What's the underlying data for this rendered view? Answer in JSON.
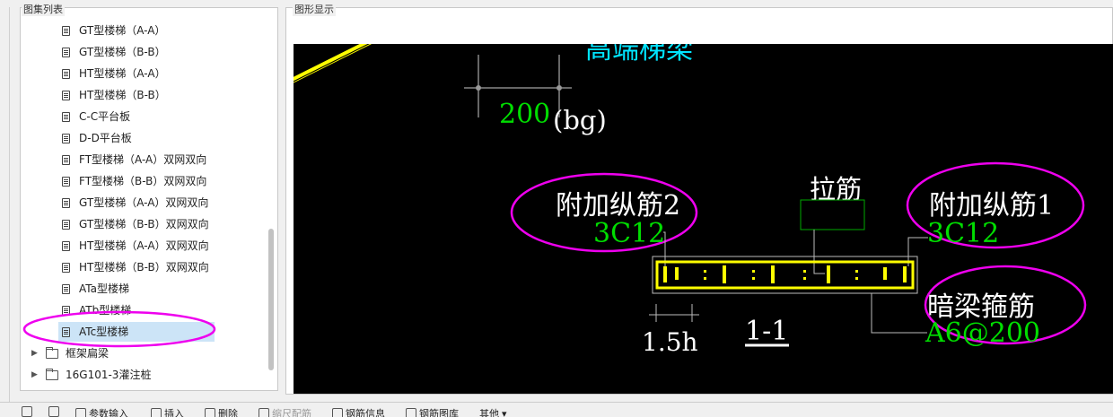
{
  "left_panel": {
    "title": "图集列表",
    "items": [
      {
        "label": "GT型楼梯（A-A）",
        "selected": false
      },
      {
        "label": "GT型楼梯（B-B）",
        "selected": false
      },
      {
        "label": "HT型楼梯（A-A）",
        "selected": false
      },
      {
        "label": "HT型楼梯（B-B）",
        "selected": false
      },
      {
        "label": "C-C平台板",
        "selected": false
      },
      {
        "label": "D-D平台板",
        "selected": false
      },
      {
        "label": "FT型楼梯（A-A）双网双向",
        "selected": false
      },
      {
        "label": "FT型楼梯（B-B）双网双向",
        "selected": false
      },
      {
        "label": "GT型楼梯（A-A）双网双向",
        "selected": false
      },
      {
        "label": "GT型楼梯（B-B）双网双向",
        "selected": false
      },
      {
        "label": "HT型楼梯（A-A）双网双向",
        "selected": false
      },
      {
        "label": "HT型楼梯（B-B）双网双向",
        "selected": false
      },
      {
        "label": "ATa型楼梯",
        "selected": false
      },
      {
        "label": "ATb型楼梯",
        "selected": false
      },
      {
        "label": "ATc型楼梯",
        "selected": true
      }
    ],
    "folders": [
      {
        "label": "框架扁梁"
      },
      {
        "label": "16G101-3灌注桩"
      }
    ]
  },
  "right_panel": {
    "title": "图形显示"
  },
  "drawing": {
    "top_label": "高端梯梁",
    "dim_value": "200",
    "dim_suffix": "(bg)",
    "label_tie": "拉筋",
    "label_add2": "附加纵筋2",
    "value_add2": "3C12",
    "label_add1": "附加纵筋1",
    "value_add1": "3C12",
    "label_stirrup": "暗梁箍筋",
    "value_stirrup": "A6@200",
    "dim_bottom": "1.5h",
    "section_label": "1-1"
  },
  "toolbar": {
    "items": [
      "参数输入",
      "插入",
      "删除",
      "缩尺配筋",
      "钢筋信息",
      "钢筋图库",
      "其他"
    ]
  },
  "colors": {
    "canvas_bg": "#000000",
    "cyan": "#00e5ff",
    "green": "#00dd00",
    "yellow": "#ffff00",
    "magenta": "#ee00ee",
    "white": "#ffffff",
    "selection": "#cce4f7"
  }
}
